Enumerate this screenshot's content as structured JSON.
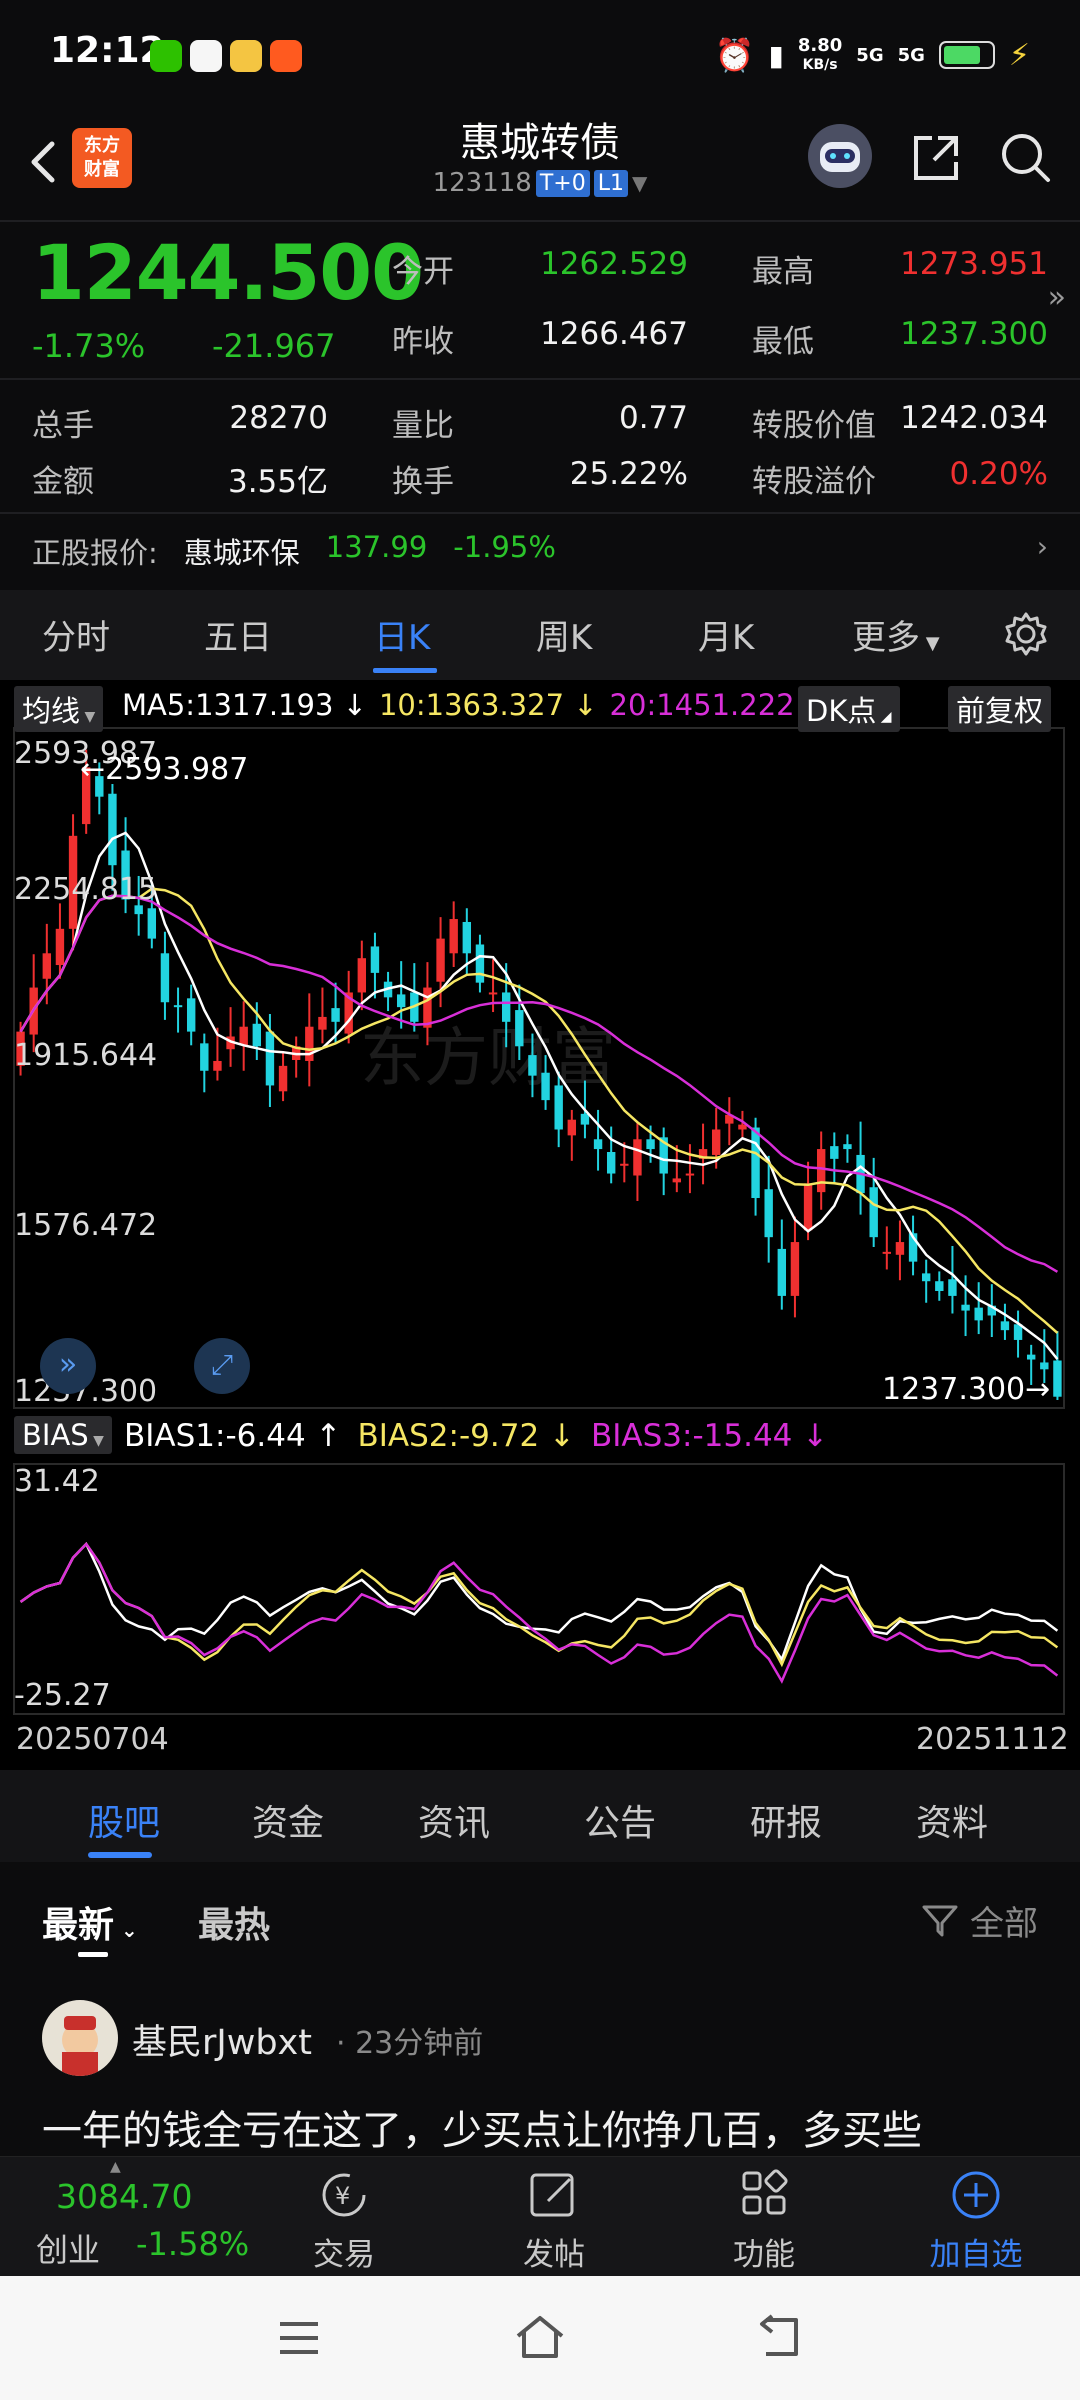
{
  "status_bar": {
    "time": "12:12",
    "net_speed": "8.80",
    "net_unit": "KB/s",
    "signal1": "5G",
    "signal2": "5G"
  },
  "header": {
    "logo_text_1": "东方",
    "logo_text_2": "财富",
    "title": "惠城转债",
    "code": "123118",
    "tag1": "T+0",
    "tag2": "L1"
  },
  "quote": {
    "price": "1244.500",
    "change_pct": "-1.73%",
    "change_val": "-21.967",
    "open_label": "今开",
    "open": "1262.529",
    "high_label": "最高",
    "high": "1273.951",
    "prev_label": "昨收",
    "prev": "1266.467",
    "low_label": "最低",
    "low": "1237.300",
    "volume_label": "总手",
    "volume": "28270",
    "ratio_label": "量比",
    "ratio": "0.77",
    "conv_value_label": "转股价值",
    "conv_value": "1242.034",
    "amount_label": "金额",
    "amount": "3.55亿",
    "turnover_label": "换手",
    "turnover": "25.22%",
    "premium_label": "转股溢价",
    "premium": "0.20%"
  },
  "underlying": {
    "label": "正股报价:",
    "name": "惠城环保",
    "price": "137.99",
    "change": "-1.95%"
  },
  "period_tabs": [
    "分时",
    "五日",
    "日K",
    "周K",
    "月K",
    "更多"
  ],
  "chart_controls": {
    "ma_selector": "均线",
    "ma5": "MA5:1317.193 ↓",
    "ma10": "10:1363.327 ↓",
    "ma20": "20:1451.222 ↓",
    "dk_button": "DK点",
    "adjust_button": "前复权",
    "bias_selector": "BIAS",
    "bias1": "BIAS1:-6.44 ↑",
    "bias2": "BIAS2:-9.72 ↓",
    "bias3": "BIAS3:-15.44 ↓",
    "max_marker": "←2593.987",
    "min_marker": "1237.300→",
    "start_date": "20250704",
    "end_date": "20251112"
  },
  "colors": {
    "up": "#f03030",
    "down": "#22d3e0",
    "ma5": "#ffffff",
    "ma10": "#f5e663",
    "ma20": "#d82fd8",
    "accent": "#3a82f7"
  },
  "chart_data": [
    {
      "type": "candlestick",
      "y_ticks": [
        "2593.987",
        "2254.815",
        "1915.644",
        "1576.472",
        "1237.300"
      ],
      "ylim": [
        1237.3,
        2593.987
      ],
      "closes": [
        1990,
        2080,
        2150,
        2200,
        2390,
        2530,
        2470,
        2330,
        2260,
        2230,
        2180,
        2050,
        2040,
        1990,
        1910,
        1930,
        1980,
        2000,
        1960,
        1880,
        1920,
        1960,
        2000,
        2020,
        2010,
        2070,
        2140,
        2110,
        2060,
        2040,
        2010,
        2080,
        2180,
        2220,
        2150,
        2090,
        2070,
        2010,
        1960,
        1900,
        1850,
        1790,
        1810,
        1800,
        1750,
        1700,
        1720,
        1770,
        1750,
        1700,
        1690,
        1700,
        1750,
        1790,
        1820,
        1800,
        1650,
        1570,
        1450,
        1560,
        1680,
        1750,
        1730,
        1750,
        1660,
        1570,
        1540,
        1560,
        1520,
        1480,
        1460,
        1450,
        1420,
        1400,
        1410,
        1380,
        1360,
        1320,
        1300,
        1244
      ]
    },
    {
      "type": "line",
      "name": "BIAS",
      "y_ticks": [
        "31.42",
        "-25.27"
      ],
      "ylim": [
        -25.27,
        31.42
      ]
    }
  ],
  "content_tabs": [
    "股吧",
    "资金",
    "资讯",
    "公告",
    "研报",
    "资料"
  ],
  "sort": {
    "latest": "最新",
    "hot": "最热",
    "filter": "全部"
  },
  "post": {
    "user": "基民rJwbxt",
    "time": "23分钟前",
    "text": "一年的钱全亏在这了，少买点让你挣几百，多买些"
  },
  "bottom_bar": {
    "index_value": "3084.70",
    "index_name": "创业",
    "index_change": "-1.58%",
    "trade": "交易",
    "post": "发帖",
    "function": "功能",
    "add_watch": "加自选"
  }
}
